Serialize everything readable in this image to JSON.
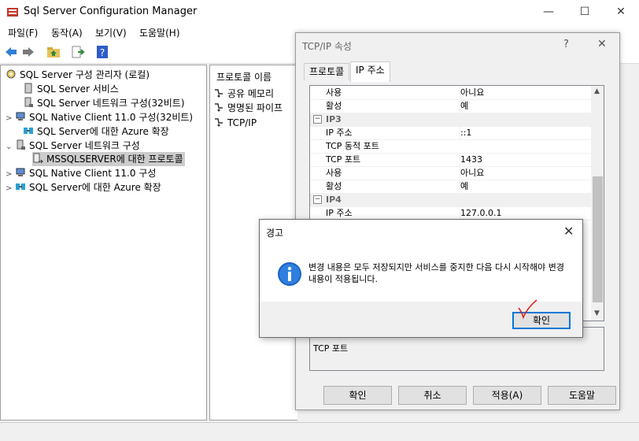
{
  "window": {
    "title": "Sql Server Configuration Manager",
    "min": "—",
    "max": "☐",
    "close": "✕"
  },
  "menu": [
    "파일(F)",
    "동작(A)",
    "보기(V)",
    "도움말(H)"
  ],
  "tree": {
    "root": "SQL Server 구성 관리자 (로컬)",
    "items": [
      {
        "label": "SQL Server 서비스",
        "twisty": ""
      },
      {
        "label": "SQL Server 네트워크 구성(32비트)",
        "twisty": ""
      },
      {
        "label": "SQL Native Client 11.0 구성(32비트)",
        "twisty": ">"
      },
      {
        "label": "SQL Server에 대한 Azure 확장",
        "twisty": ""
      },
      {
        "label": "SQL Server 네트워크 구성",
        "twisty": "⌄"
      },
      {
        "label": "MSSQLSERVER에 대한 프로토콜",
        "twisty": ""
      },
      {
        "label": "SQL Native Client 11.0 구성",
        "twisty": ">"
      },
      {
        "label": "SQL Server에 대한 Azure 확장",
        "twisty": ">"
      }
    ]
  },
  "list": {
    "header": "프로토콜 이름",
    "items": [
      "공유 메모리",
      "명명된 파이프",
      "TCP/IP"
    ]
  },
  "tcp_dialog": {
    "title": "TCP/IP 속성",
    "help": "?",
    "close": "✕",
    "tabs": [
      "프로토콜",
      "IP 주소"
    ],
    "rows": [
      {
        "k": "사용",
        "v": "아니요",
        "cat": false
      },
      {
        "k": "활성",
        "v": "예",
        "cat": false
      },
      {
        "k": "IP3",
        "v": "",
        "cat": true
      },
      {
        "k": "IP 주소",
        "v": "::1",
        "cat": false
      },
      {
        "k": "TCP 동적 포트",
        "v": "",
        "cat": false
      },
      {
        "k": "TCP 포트",
        "v": "1433",
        "cat": false
      },
      {
        "k": "사용",
        "v": "아니요",
        "cat": false
      },
      {
        "k": "활성",
        "v": "예",
        "cat": false
      },
      {
        "k": "IP4",
        "v": "",
        "cat": true
      },
      {
        "k": "IP 주소",
        "v": "127.0.0.1",
        "cat": false
      }
    ],
    "description": "TCP 포트",
    "buttons": [
      "확인",
      "취소",
      "적용(A)",
      "도움말"
    ]
  },
  "alert": {
    "title": "경고",
    "close": "✕",
    "message": "변경 내용은 모두 저장되지만 서비스를 중지한 다음 다시 시작해야 변경 내용이 적용됩니다.",
    "ok_label": "확인"
  },
  "colors": {
    "accent": "#0078d7",
    "check": "#e8201c"
  }
}
